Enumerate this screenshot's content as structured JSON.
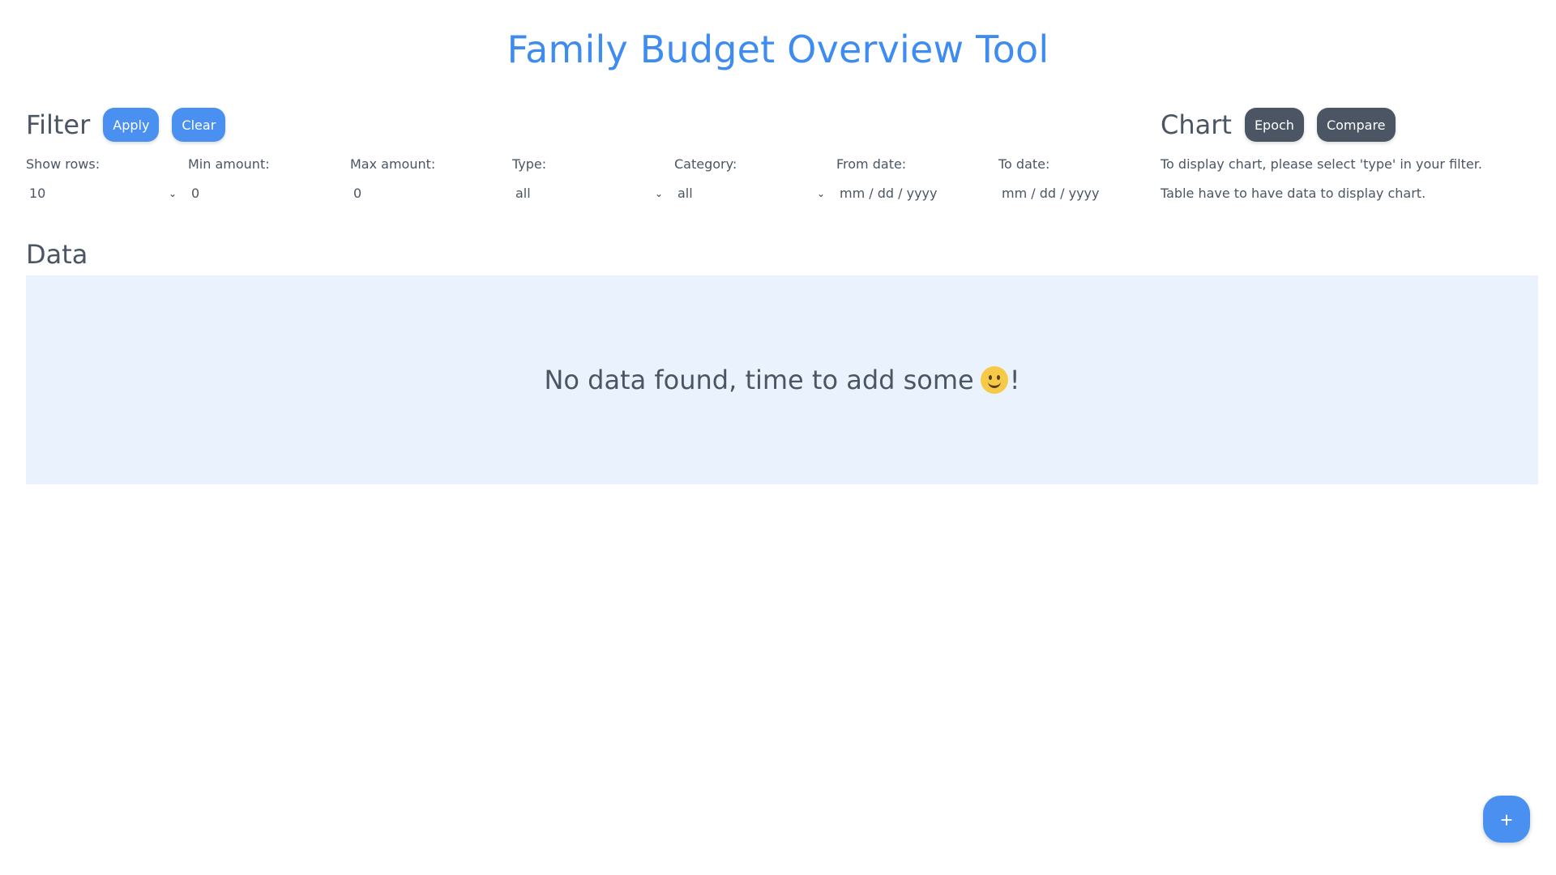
{
  "app": {
    "title": "Family Budget Overview Tool"
  },
  "filter": {
    "title": "Filter",
    "apply_label": "Apply",
    "clear_label": "Clear",
    "fields": {
      "show_rows": {
        "label": "Show rows:",
        "value": "10"
      },
      "min_amount": {
        "label": "Min amount:",
        "value": "0"
      },
      "max_amount": {
        "label": "Max amount:",
        "value": "0"
      },
      "type": {
        "label": "Type:",
        "value": "all"
      },
      "category": {
        "label": "Category:",
        "value": "all"
      },
      "from_date": {
        "label": "From date:",
        "placeholder": "mm / dd / yyyy"
      },
      "to_date": {
        "label": "To date:",
        "placeholder": "mm / dd / yyyy"
      }
    }
  },
  "chart": {
    "title": "Chart",
    "epoch_label": "Epoch",
    "compare_label": "Compare",
    "info_line_1": "To display chart, please select 'type' in your filter.",
    "info_line_2": "Table have to have data to display chart."
  },
  "data": {
    "title": "Data",
    "empty_message": "No data found, time to add some",
    "empty_suffix": "!"
  },
  "fab": {
    "label": "+"
  },
  "icons": {
    "dropdown": "chevron-down-icon",
    "empty_state": "smiley-icon",
    "add": "plus-icon"
  },
  "colors": {
    "accent": "#4a90f0",
    "title": "#3f8cf0",
    "text": "#4b5563",
    "dark_button": "#4b5563",
    "empty_bg": "#eaf3fd"
  }
}
